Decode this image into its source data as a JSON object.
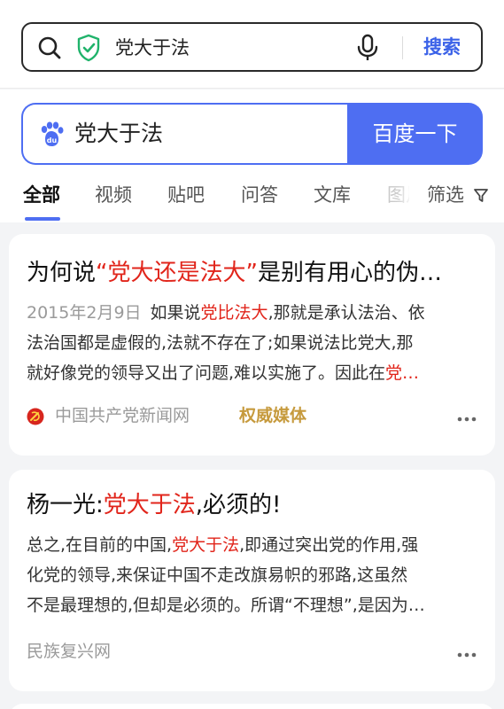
{
  "browser": {
    "query": "党大于法",
    "search_button": "搜索"
  },
  "baidu": {
    "query": "党大于法",
    "go_button": "百度一下",
    "accent": "#4e6ef2"
  },
  "tabs": [
    {
      "label": "全部",
      "active": true
    },
    {
      "label": "视频"
    },
    {
      "label": "贴吧"
    },
    {
      "label": "问答"
    },
    {
      "label": "文库"
    },
    {
      "label": "图片"
    }
  ],
  "filter_label": "筛选",
  "results": [
    {
      "title": {
        "pre": "为何说",
        "hl": "“党大还是法大”",
        "post": "是别有用心的伪…"
      },
      "date": "2015年2月9日",
      "abstract": {
        "l1_pre": "如果说",
        "l1_hl": "党比法大",
        "l1_post": ",那就是承认法治、依",
        "l2": "法治国都是虚假的,法就不存在了;如果说法比党大,那",
        "l3_pre": "就好像党的领导又出了问题,难以实施了。因此在",
        "l3_hl": "党…"
      },
      "source": "中国共产党新闻网",
      "badge": "权威媒体"
    },
    {
      "title": {
        "pre": "杨一光:",
        "hl": "党大于法",
        "post": ",必须的!"
      },
      "abstract": {
        "l1_pre": "总之,在目前的中国,",
        "l1_hl": "党大于法",
        "l1_post": ",即通过突出党的作用,强",
        "l2": "化党的领导,来保证中国不走改旗易帜的邪路,这虽然",
        "l3": "不是最理想的,但却是必须的。所谓“不理想”,是因为…"
      },
      "source": "民族复兴网"
    }
  ],
  "colors": {
    "highlight": "#e1251b",
    "badge": "#c69a3d"
  }
}
